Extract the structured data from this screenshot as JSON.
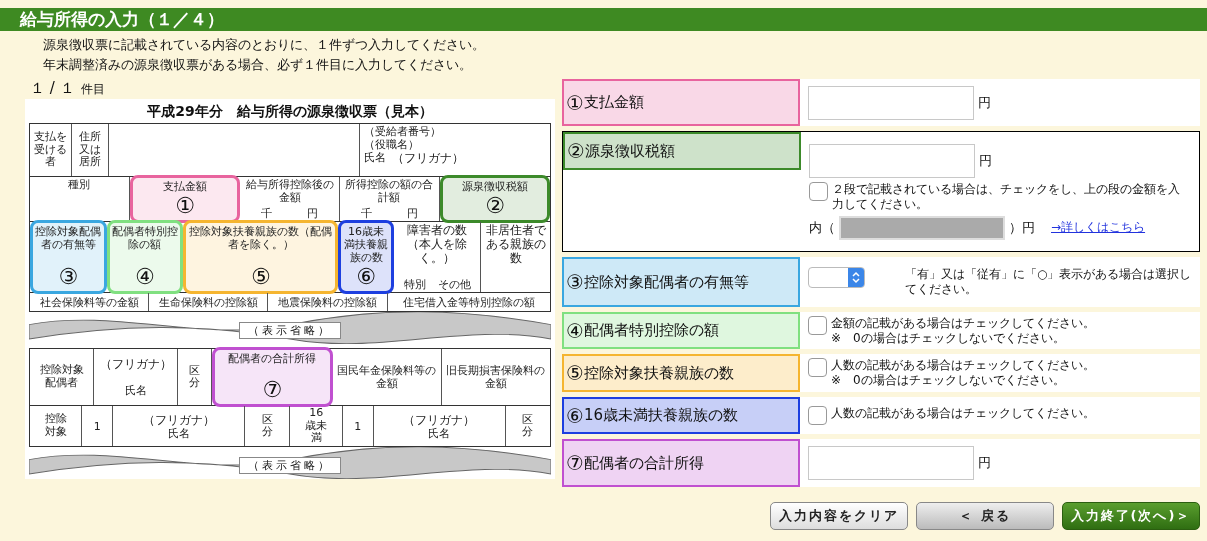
{
  "header": {
    "title": "給与所得の入力（１／４）"
  },
  "instructions": [
    "源泉徴収票に記載されている内容のとおりに、１件ずつ入力してください。",
    "年末調整済みの源泉徴収票がある場合、必ず１件目に入力してください。"
  ],
  "counter": {
    "value": "１ / １",
    "unit": "件目"
  },
  "slip": {
    "title": "平成29年分　給与所得の源泉徴収票（見本）",
    "payee": {
      "label": "支払を受ける者",
      "address_label": "住所又は居所",
      "recipient_no": "（受給者番号）",
      "position": "（役職名）",
      "name_label": "氏名",
      "kana": "（フリガナ）"
    },
    "amounts": [
      {
        "label": "種別"
      },
      {
        "label": "支払金額",
        "marker": "①",
        "color": "#e8649e"
      },
      {
        "label": "給与所得控除後の金額",
        "units": [
          "千",
          "円"
        ]
      },
      {
        "label": "所得控除の額の合計額",
        "units": [
          "千",
          "円"
        ]
      },
      {
        "label": "源泉徴収税額",
        "marker": "②",
        "color": "#3c8a2a"
      }
    ],
    "counts": [
      {
        "label": "控除対象配偶者の有無等",
        "marker": "③",
        "color": "#3aa7e0"
      },
      {
        "label": "配偶者特別控除の額",
        "marker": "④",
        "color": "#80e080"
      },
      {
        "label": "控除対象扶養親族の数（配偶者を除く。）",
        "marker": "⑤",
        "color": "#f5b530"
      },
      {
        "label": "16歳未満扶養親族の数",
        "marker": "⑥",
        "color": "#1d3fe0"
      },
      {
        "label": "障害者の数（本人を除く。）",
        "sub": [
          "特別",
          "その他"
        ]
      },
      {
        "label": "非居住者である親族の数"
      }
    ],
    "deductions": [
      "社会保険料等の金額",
      "生命保険料の控除額",
      "地震保険料の控除額",
      "住宅借入金等特別控除の額"
    ],
    "omitted_1": "（表示省略）",
    "spouse": {
      "label": "控除対象配偶者",
      "kana": "（フリガナ）",
      "name": "氏名",
      "category": "区分"
    },
    "spouse_income": {
      "label": "配偶者の合計所得",
      "marker": "⑦",
      "color": "#c050d0"
    },
    "others": [
      "国民年金保険料等の金額",
      "旧長期損害保険料の金額"
    ],
    "dependents": {
      "label": "控除対象",
      "index": "1",
      "kana": "（フリガナ）",
      "name": "氏名",
      "category": "区分"
    },
    "under16": {
      "label": "16歳未満",
      "index": "1",
      "kana": "（フリガナ）",
      "name": "氏名",
      "category": "区分"
    },
    "omitted_2": "（表示省略）"
  },
  "fields": [
    {
      "kind": "amount",
      "number": "①",
      "label": "支払金額",
      "color": "#e8649e",
      "unit": "円"
    },
    {
      "kind": "amount_split",
      "number": "②",
      "label": "源泉徴収税額",
      "color": "#3c8a2a",
      "unit": "円",
      "checkbox": {
        "checked": false,
        "note": "２段で記載されている場合は、チェックをし、上の段の金額を入力してください。"
      },
      "inner": {
        "prefix": "内（",
        "suffix": "）円",
        "disabled": true
      },
      "link": "→詳しくはこちら"
    },
    {
      "kind": "select",
      "number": "③",
      "label": "控除対象配偶者の有無等",
      "color": "#3aa7e0",
      "note": "「有」又は「従有」に「○」表示がある場合は選択してください。"
    },
    {
      "kind": "check",
      "number": "④",
      "label": "配偶者特別控除の額",
      "color": "#80e080",
      "checked": false,
      "note": "金額の記載がある場合はチェックしてください。",
      "subnote": "※　0の場合はチェックしないでください。"
    },
    {
      "kind": "check",
      "number": "⑤",
      "label": "控除対象扶養親族の数",
      "color": "#f5b530",
      "checked": false,
      "note": "人数の記載がある場合はチェックしてください。",
      "subnote": "※　0の場合はチェックしないでください。"
    },
    {
      "kind": "check",
      "number": "⑥",
      "label": "16歳未満扶養親族の数",
      "color": "#1d3fe0",
      "checked": false,
      "note": "人数の記載がある場合はチェックしてください。"
    },
    {
      "kind": "amount",
      "number": "⑦",
      "label": "配偶者の合計所得",
      "color": "#c050d0",
      "unit": "円"
    }
  ],
  "buttons": [
    {
      "kind": "clear",
      "label": "入力内容をクリア"
    },
    {
      "kind": "back",
      "label": "＜ 戻る"
    },
    {
      "kind": "next",
      "label": "入力終了(次へ)＞"
    }
  ]
}
